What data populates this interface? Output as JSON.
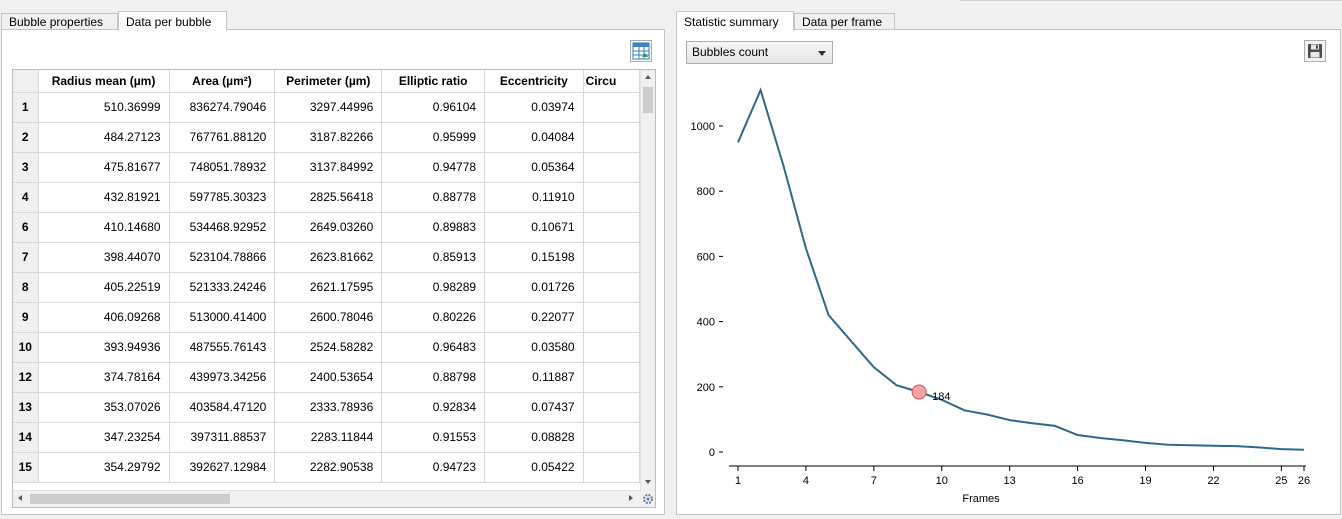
{
  "left": {
    "tabs": [
      {
        "label": "Bubble properties",
        "active": false
      },
      {
        "label": "Data per bubble",
        "active": true
      }
    ],
    "export_button_icon": "table-export-icon",
    "table": {
      "columns": [
        "Radius mean (µm)",
        "Area (µm²)",
        "Perimeter (µm)",
        "Elliptic ratio",
        "Eccentricity",
        "Circu"
      ],
      "rows": [
        {
          "id": "1",
          "cells": [
            "510.36999",
            "836274.79046",
            "3297.44996",
            "0.96104",
            "0.03974",
            ""
          ]
        },
        {
          "id": "2",
          "cells": [
            "484.27123",
            "767761.88120",
            "3187.82266",
            "0.95999",
            "0.04084",
            ""
          ]
        },
        {
          "id": "3",
          "cells": [
            "475.81677",
            "748051.78932",
            "3137.84992",
            "0.94778",
            "0.05364",
            ""
          ]
        },
        {
          "id": "4",
          "cells": [
            "432.81921",
            "597785.30323",
            "2825.56418",
            "0.88778",
            "0.11910",
            ""
          ]
        },
        {
          "id": "6",
          "cells": [
            "410.14680",
            "534468.92952",
            "2649.03260",
            "0.89883",
            "0.10671",
            ""
          ]
        },
        {
          "id": "7",
          "cells": [
            "398.44070",
            "523104.78866",
            "2623.81662",
            "0.85913",
            "0.15198",
            ""
          ]
        },
        {
          "id": "8",
          "cells": [
            "405.22519",
            "521333.24246",
            "2621.17595",
            "0.98289",
            "0.01726",
            ""
          ]
        },
        {
          "id": "9",
          "cells": [
            "406.09268",
            "513000.41400",
            "2600.78046",
            "0.80226",
            "0.22077",
            ""
          ]
        },
        {
          "id": "10",
          "cells": [
            "393.94936",
            "487555.76143",
            "2524.58282",
            "0.96483",
            "0.03580",
            ""
          ]
        },
        {
          "id": "12",
          "cells": [
            "374.78164",
            "439973.34256",
            "2400.53654",
            "0.88798",
            "0.11887",
            ""
          ]
        },
        {
          "id": "13",
          "cells": [
            "353.07026",
            "403584.47120",
            "2333.78936",
            "0.92834",
            "0.07437",
            ""
          ]
        },
        {
          "id": "14",
          "cells": [
            "347.23254",
            "397311.88537",
            "2283.11844",
            "0.91553",
            "0.08828",
            ""
          ]
        },
        {
          "id": "15",
          "cells": [
            "354.29792",
            "392627.12984",
            "2282.90538",
            "0.94723",
            "0.05422",
            ""
          ]
        }
      ]
    }
  },
  "right": {
    "tabs": [
      {
        "label": "Statistic summary",
        "active": true
      },
      {
        "label": "Data per frame",
        "active": false
      }
    ],
    "statistic_select": {
      "value": "Bubbles count"
    },
    "save_button_icon": "floppy-disk-icon"
  },
  "chart_data": {
    "type": "line",
    "title": "",
    "xlabel": "Frames",
    "ylabel": "",
    "x": [
      1,
      2,
      3,
      4,
      5,
      6,
      7,
      8,
      9,
      10,
      11,
      12,
      13,
      14,
      15,
      16,
      17,
      18,
      19,
      20,
      21,
      22,
      23,
      24,
      25,
      26
    ],
    "series": [
      {
        "values": [
          950,
          1110,
          880,
          625,
          420,
          340,
          260,
          205,
          184,
          160,
          128,
          115,
          98,
          88,
          80,
          52,
          43,
          36,
          28,
          22,
          21,
          19,
          18,
          14,
          9,
          7
        ]
      }
    ],
    "xticks": [
      1,
      4,
      7,
      10,
      13,
      16,
      19,
      22,
      25,
      26
    ],
    "yticks": [
      0,
      200,
      400,
      600,
      800,
      1000
    ],
    "xlim": [
      1,
      26
    ],
    "ylim": [
      0,
      1100
    ],
    "grid": false,
    "colors": {
      "line": "#2f6a8a",
      "highlight_fill": "#f4a6a6",
      "highlight_stroke": "#d9534f"
    },
    "highlight": {
      "x": 9,
      "y": 184,
      "label": "184"
    }
  }
}
